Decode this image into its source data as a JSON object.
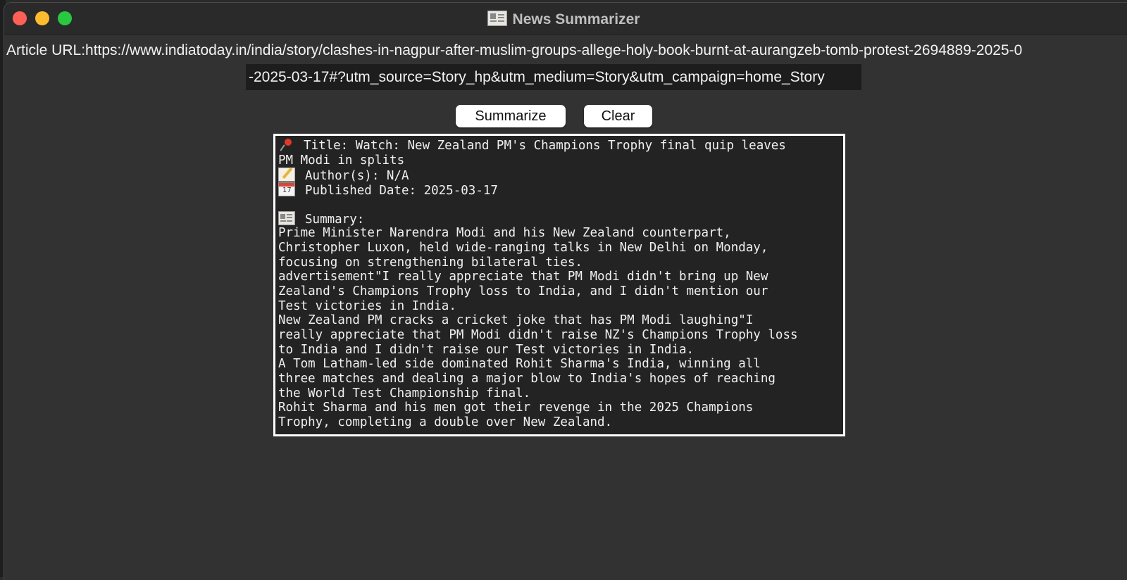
{
  "window": {
    "title": "News Summarizer",
    "title_icon": "newspaper-icon"
  },
  "form": {
    "url_label": "Article URL:",
    "url_value_line1": "https://www.indiatoday.in/india/story/clashes-in-nagpur-after-muslim-groups-allege-holy-book-burnt-at-aurangzeb-tomb-protest-2694889-2025-0",
    "url_value_line2": "-2025-03-17#?utm_source=Story_hp&utm_medium=Story&utm_campaign=home_Story"
  },
  "buttons": {
    "summarize": "Summarize",
    "clear": "Clear"
  },
  "output": {
    "title_line1": "Title: Watch: New Zealand PM's Champions Trophy final quip leaves",
    "title_line2": "PM Modi in splits",
    "author_line": "Author(s): N/A",
    "date_line": "Published Date: 2025-03-17",
    "summary_label": "Summary:",
    "summary_lines": [
      "Prime Minister Narendra Modi and his New Zealand counterpart,",
      "Christopher Luxon, held wide-ranging talks in New Delhi on Monday,",
      "focusing on strengthening bilateral ties.",
      "advertisement\"I really appreciate that PM Modi didn't bring up New",
      "Zealand's Champions Trophy loss to India, and I didn't mention our",
      "Test victories in India.",
      "New Zealand PM cracks a cricket joke that has PM Modi laughing\"I",
      "really appreciate that PM Modi didn't raise NZ's Champions Trophy loss",
      "to India and I didn't raise our Test victories in India.",
      "A Tom Latham-led side dominated Rohit Sharma's India, winning all",
      "three matches and dealing a major blow to India's hopes of reaching",
      "the World Test Championship final.",
      "Rohit Sharma and his men got their revenge in the 2025 Champions",
      "Trophy, completing a double over New Zealand."
    ]
  },
  "colors": {
    "window_bg": "#323232",
    "output_bg": "#232323",
    "close": "#fe5f57",
    "minimize": "#febc2e",
    "maximize": "#28c840"
  }
}
